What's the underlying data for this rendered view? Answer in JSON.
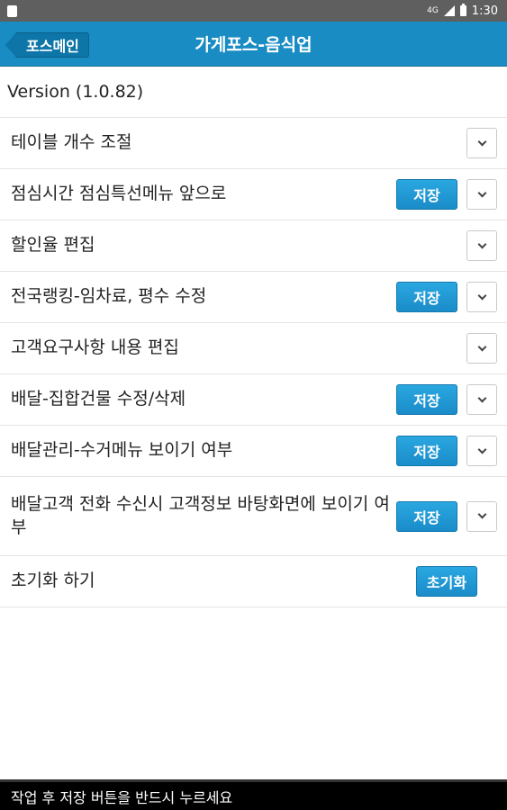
{
  "status_bar": {
    "time": "1:30",
    "network": "4G"
  },
  "header": {
    "back_label": "포스메인",
    "title": "가게포스-음식업"
  },
  "version": "Version (1.0.82)",
  "settings": [
    {
      "label": "테이블 개수 조절",
      "has_save": false,
      "save_label": ""
    },
    {
      "label": "점심시간 점심특선메뉴 앞으로",
      "has_save": true,
      "save_label": "저장"
    },
    {
      "label": "할인율 편집",
      "has_save": false,
      "save_label": ""
    },
    {
      "label": "전국랭킹-임차료, 평수 수정",
      "has_save": true,
      "save_label": "저장"
    },
    {
      "label": "고객요구사항 내용 편집",
      "has_save": false,
      "save_label": ""
    },
    {
      "label": "배달-집합건물 수정/삭제",
      "has_save": true,
      "save_label": "저장"
    },
    {
      "label": "배달관리-수거메뉴 보이기 여부",
      "has_save": true,
      "save_label": "저장"
    },
    {
      "label": "배달고객 전화 수신시 고객정보 바탕화면에 보이기 여부",
      "has_save": true,
      "save_label": "저장"
    }
  ],
  "reset": {
    "label": "초기화 하기",
    "button_label": "초기화"
  },
  "footer": {
    "message": "작업 후 저장 버튼을 반드시 누르세요"
  },
  "colors": {
    "accent": "#1a8cc4",
    "footer_bg": "#000000",
    "status_bar": "#5f5f5f"
  }
}
